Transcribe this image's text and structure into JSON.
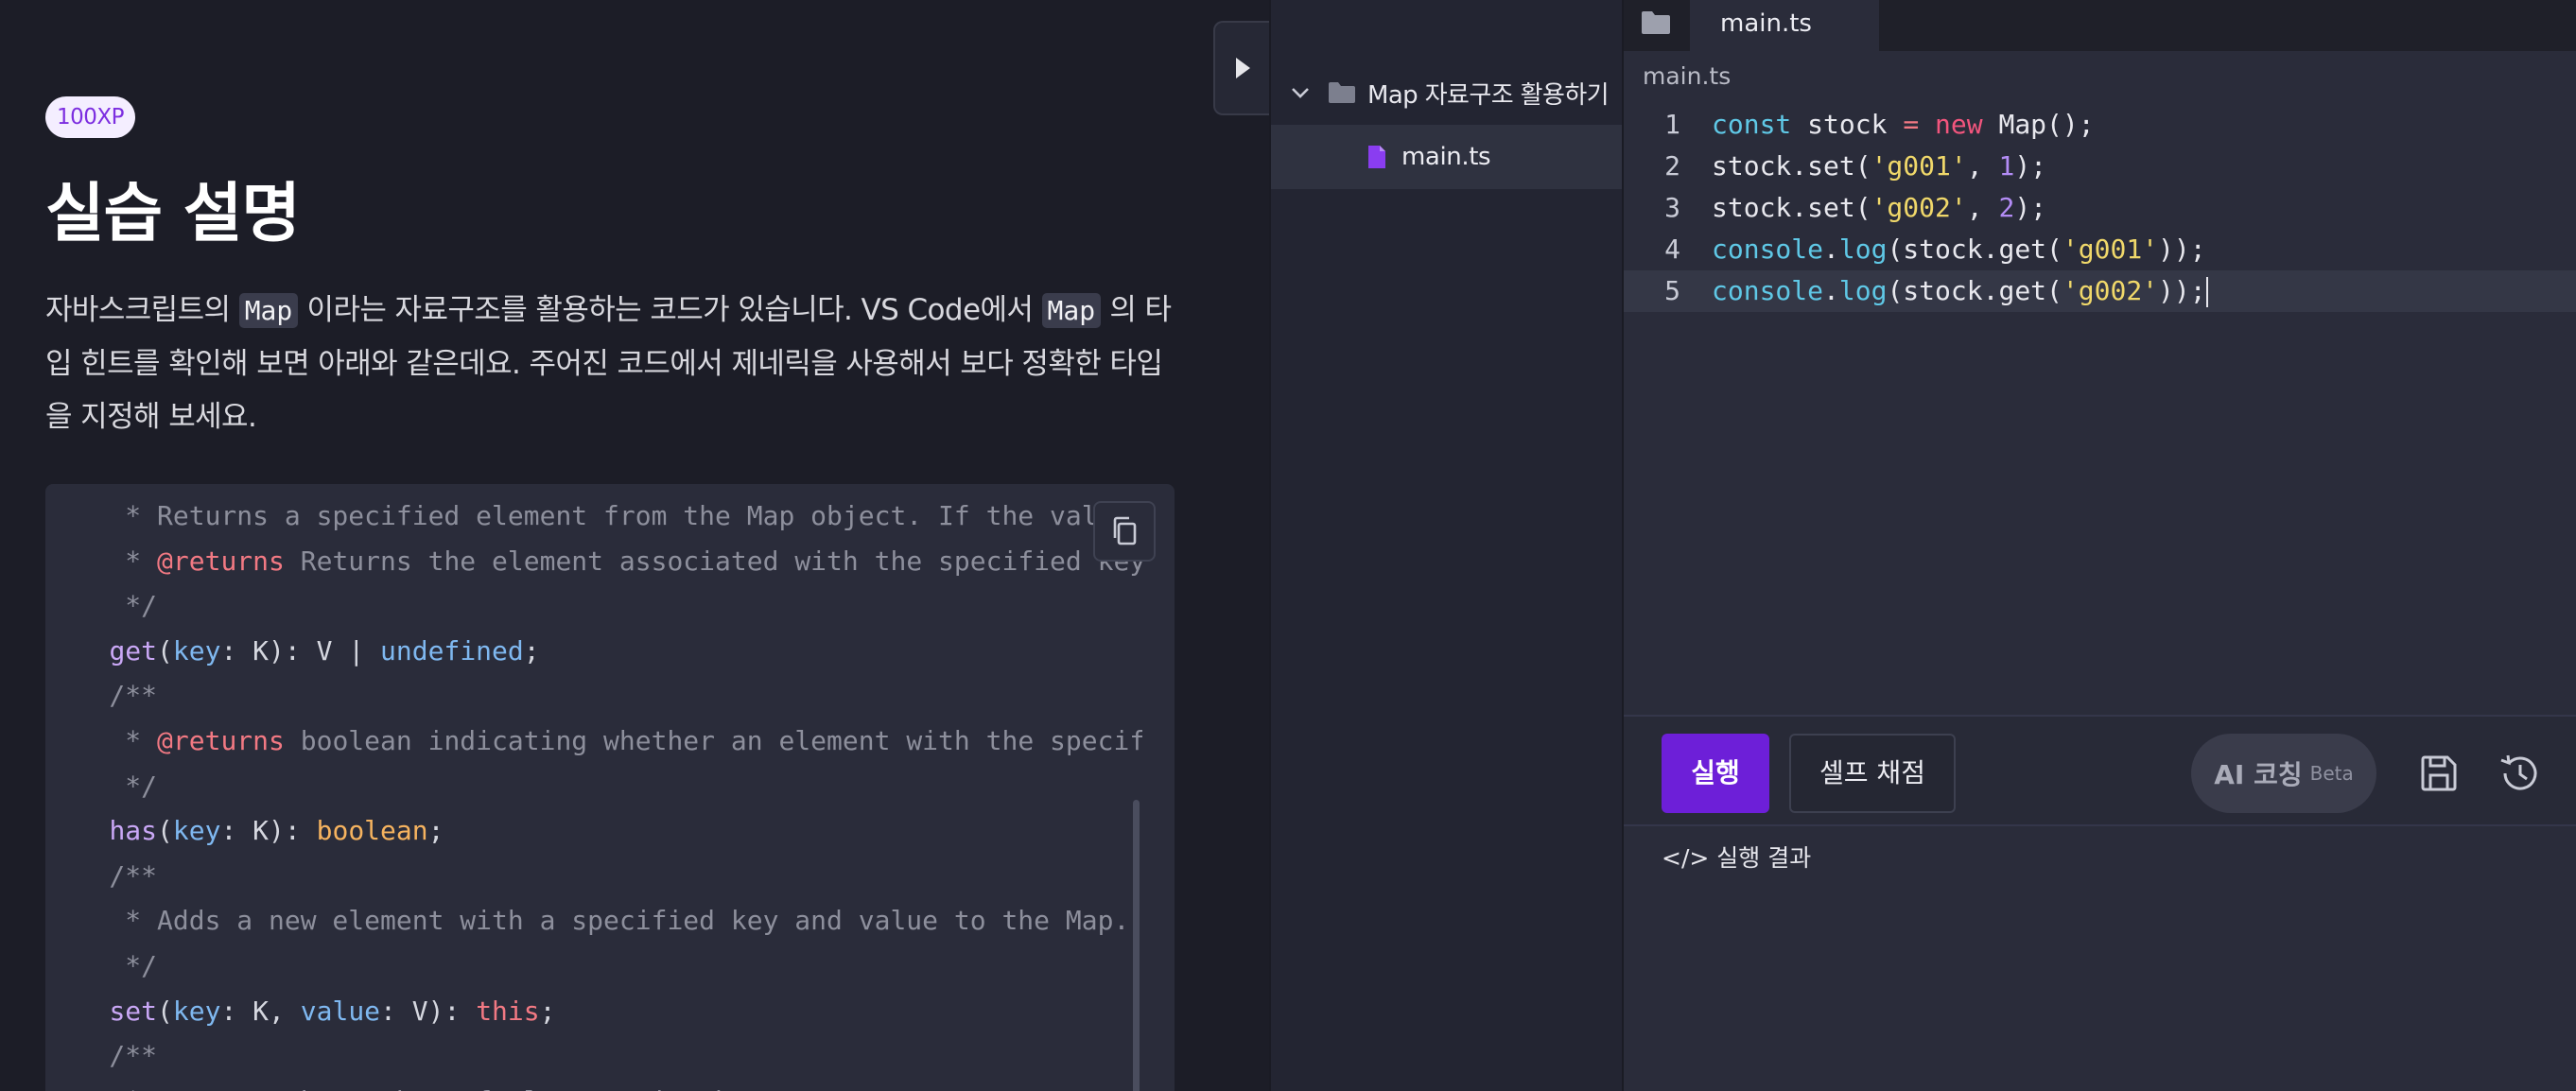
{
  "exercise": {
    "xp_badge": "100XP",
    "title": "실습 설명",
    "description_parts": [
      "자바스크립트의 ",
      "Map",
      " 이라는 자료구조를 활용하는 코드가 있습니다.  VS Code에서 ",
      "Map",
      " 의 타입 힌트를 확인해 보면 아래와 같은데요. 주어진 코드에서 제네릭을 사용해서 보다 정확한 타입을 지정해 보세요."
    ],
    "code_lines": [
      [
        [
          "com",
          "     * Returns a specified element from the Map object. If the value that is associated to the provided key is an object, then you will get a reference to that object and any change made to that object will effectively modify it inside the Map."
        ]
      ],
      [
        [
          "com",
          "     * "
        ],
        [
          "tag",
          "@returns"
        ],
        [
          "com",
          " Returns the element associated with the specified key. If no element is associated with the specified key, undefined is returned."
        ]
      ],
      [
        [
          "com",
          "     */"
        ]
      ],
      [
        [
          "plain",
          "    "
        ],
        [
          "fn",
          "get"
        ],
        [
          "plain",
          "("
        ],
        [
          "param",
          "key"
        ],
        [
          "plain",
          ": K): V | "
        ],
        [
          "undef",
          "undefined"
        ],
        [
          "plain",
          ";"
        ]
      ],
      [
        [
          "com",
          "    /**"
        ]
      ],
      [
        [
          "com",
          "     * "
        ],
        [
          "tag",
          "@returns"
        ],
        [
          "com",
          " boolean indicating whether an element with the specified key exists or not."
        ]
      ],
      [
        [
          "com",
          "     */"
        ]
      ],
      [
        [
          "plain",
          "    "
        ],
        [
          "fn",
          "has"
        ],
        [
          "plain",
          "("
        ],
        [
          "param",
          "key"
        ],
        [
          "plain",
          ": K): "
        ],
        [
          "bool",
          "boolean"
        ],
        [
          "plain",
          ";"
        ]
      ],
      [
        [
          "com",
          "    /**"
        ]
      ],
      [
        [
          "com",
          "     * Adds a new element with a specified key and value to the Map. If an element with the same key already exists, the element will be updated."
        ]
      ],
      [
        [
          "com",
          "     */"
        ]
      ],
      [
        [
          "plain",
          "    "
        ],
        [
          "fn",
          "set"
        ],
        [
          "plain",
          "("
        ],
        [
          "param",
          "key"
        ],
        [
          "plain",
          ": K, "
        ],
        [
          "param",
          "value"
        ],
        [
          "plain",
          ": V): "
        ],
        [
          "this",
          "this"
        ],
        [
          "plain",
          ";"
        ]
      ],
      [
        [
          "com",
          "    /**"
        ]
      ],
      [
        [
          "com",
          "     * Returns the number of elements in the Map."
        ]
      ]
    ]
  },
  "explorer": {
    "folder_name": "Map 자료구조 활용하기",
    "file_name": "main.ts"
  },
  "editor": {
    "tab_label": "main.ts",
    "breadcrumb": "main.ts",
    "current_line": 5,
    "lines": [
      [
        [
          "kw",
          "const"
        ],
        [
          "plain",
          " stock "
        ],
        [
          "op",
          "="
        ],
        [
          "plain",
          " "
        ],
        [
          "new",
          "new"
        ],
        [
          "plain",
          " Map();"
        ]
      ],
      [
        [
          "plain",
          "stock.set("
        ],
        [
          "str",
          "'g001'"
        ],
        [
          "plain",
          ", "
        ],
        [
          "num",
          "1"
        ],
        [
          "plain",
          ");"
        ]
      ],
      [
        [
          "plain",
          "stock.set("
        ],
        [
          "str",
          "'g002'"
        ],
        [
          "plain",
          ", "
        ],
        [
          "num",
          "2"
        ],
        [
          "plain",
          ");"
        ]
      ],
      [
        [
          "fn",
          "console"
        ],
        [
          "plain",
          "."
        ],
        [
          "fn",
          "log"
        ],
        [
          "plain",
          "(stock.get("
        ],
        [
          "str",
          "'g001'"
        ],
        [
          "plain",
          "));"
        ]
      ],
      [
        [
          "fn",
          "console"
        ],
        [
          "plain",
          "."
        ],
        [
          "fn",
          "log"
        ],
        [
          "plain",
          "(stock.get("
        ],
        [
          "str",
          "'g002'"
        ],
        [
          "plain",
          "));"
        ]
      ]
    ]
  },
  "actions": {
    "run_label": "실행",
    "self_grade_label": "셀프 채점",
    "ai_coaching_label": "AI 코칭",
    "ai_coaching_badge": "Beta",
    "result_label": "</> 실행 결과"
  },
  "icons": {
    "copy": "copy-icon",
    "collapse": "play-triangle-icon",
    "chevron": "chevron-down-icon",
    "folder": "folder-icon",
    "file": "file-icon",
    "save": "save-icon",
    "history": "history-icon"
  },
  "colors": {
    "accent": "#6d1fd8",
    "file_icon": "#8a3df0",
    "badge_text": "#7c2ee0"
  }
}
